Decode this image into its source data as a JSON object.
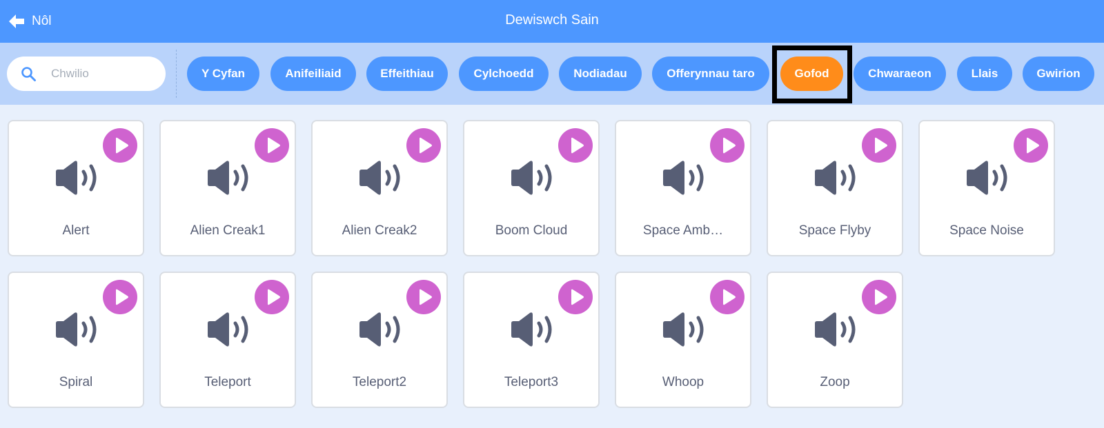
{
  "header": {
    "back_label": "Nôl",
    "title": "Dewiswch Sain"
  },
  "search": {
    "placeholder": "Chwilio",
    "value": ""
  },
  "tags": [
    {
      "label": "Y Cyfan",
      "active": false
    },
    {
      "label": "Anifeiliaid",
      "active": false
    },
    {
      "label": "Effeithiau",
      "active": false
    },
    {
      "label": "Cylchoedd",
      "active": false
    },
    {
      "label": "Nodiadau",
      "active": false
    },
    {
      "label": "Offerynnau taro",
      "active": false
    },
    {
      "label": "Gofod",
      "active": true
    },
    {
      "label": "Chwaraeon",
      "active": false
    },
    {
      "label": "Llais",
      "active": false
    },
    {
      "label": "Gwirion",
      "active": false
    }
  ],
  "sounds": [
    {
      "name": "Alert"
    },
    {
      "name": "Alien Creak1"
    },
    {
      "name": "Alien Creak2"
    },
    {
      "name": "Boom Cloud"
    },
    {
      "name": "Space Amb…"
    },
    {
      "name": "Space Flyby"
    },
    {
      "name": "Space Noise"
    },
    {
      "name": "Spiral"
    },
    {
      "name": "Teleport"
    },
    {
      "name": "Teleport2"
    },
    {
      "name": "Teleport3"
    },
    {
      "name": "Whoop"
    },
    {
      "name": "Zoop"
    }
  ],
  "colors": {
    "header": "#4d97ff",
    "filter_bar": "#b9d3fb",
    "tag": "#4d97ff",
    "tag_active": "#ff8c1a",
    "play_button": "#cf63cf",
    "speaker_icon": "#575e75"
  },
  "icons": {
    "back": "arrow-left-icon",
    "search": "magnifier-icon",
    "sound": "speaker-icon",
    "play": "play-icon"
  }
}
